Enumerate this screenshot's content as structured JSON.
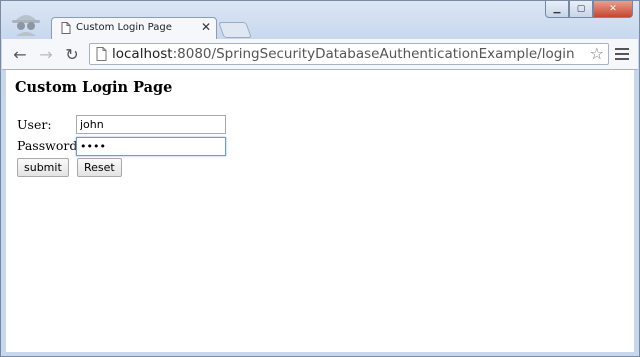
{
  "browser": {
    "tab_title": "Custom Login Page",
    "tab_close_glyph": "✕",
    "url_host": "localhost",
    "url_rest": ":8080/SpringSecurityDatabaseAuthenticationExample/login",
    "star_glyph": "☆",
    "back_glyph": "←",
    "forward_glyph": "→",
    "reload_glyph": "↻",
    "window_buttons": {
      "minimize": "▁",
      "maximize": "▢",
      "close": "✕"
    },
    "icons": [
      "incognito-icon",
      "page-icon",
      "star-icon",
      "menu-icon"
    ]
  },
  "page": {
    "heading": "Custom Login Page",
    "form": {
      "user_label": "User:",
      "user_value": "john",
      "password_label": "Password:",
      "password_value": "••••",
      "submit_label": "submit",
      "reset_label": "Reset"
    }
  },
  "colors": {
    "frame": "#c6d7ee",
    "focus_border": "#6d9cd6",
    "close_button": "#c7452e"
  }
}
